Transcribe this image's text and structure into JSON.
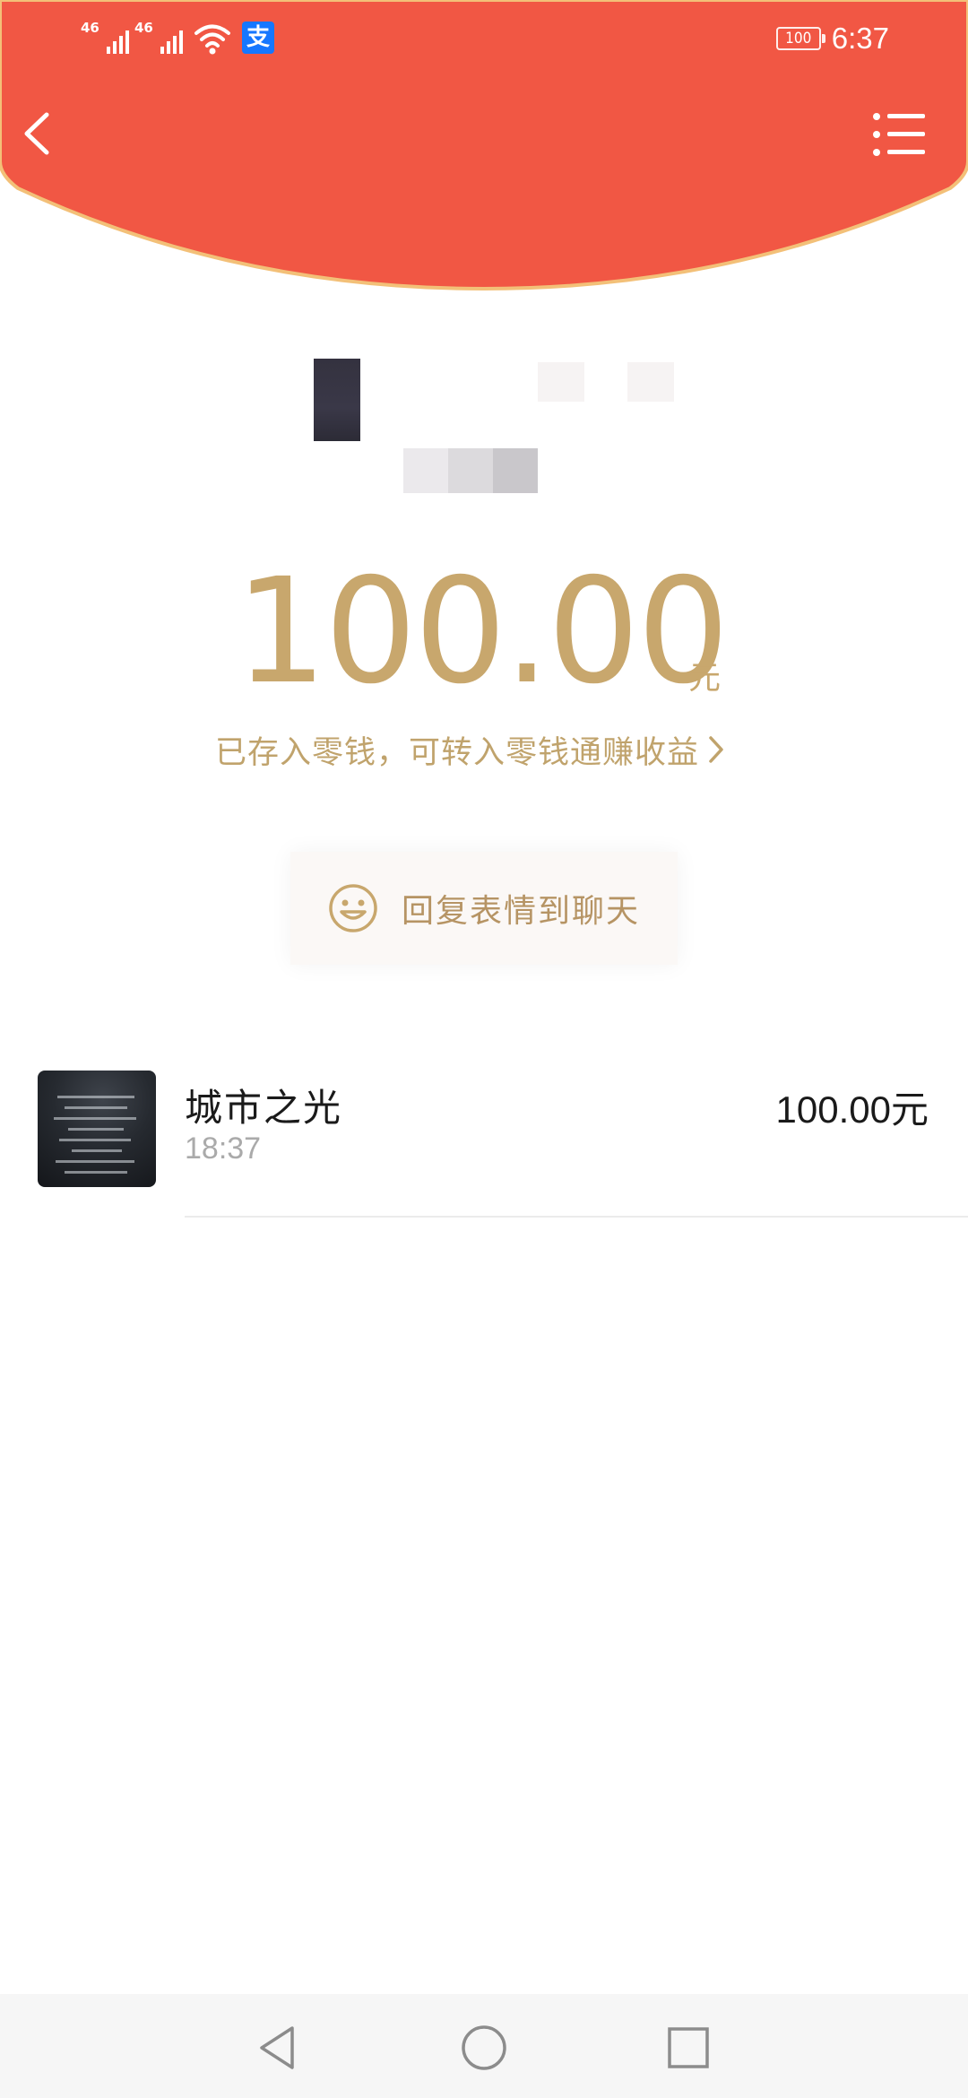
{
  "colors": {
    "header_red": "#f15744",
    "header_edge": "#f3c078",
    "gold": "#c8a76d",
    "gold_text": "#c0a36c",
    "reply_text": "#b69464"
  },
  "status_bar": {
    "network_1": "46",
    "network_2": "46",
    "wifi_icon": "wifi-icon",
    "app_icon": "alipay-icon",
    "app_icon_glyph": "支",
    "battery": "100",
    "time": "6:37"
  },
  "header": {
    "back_icon": "chevron-left-icon",
    "menu_icon": "menu-list-icon"
  },
  "packet": {
    "amount": "100.00",
    "unit": "元",
    "change_note": "已存入零钱，可转入零钱通赚收益",
    "reply_label": "回复表情到聊天",
    "reply_icon": "smile-icon"
  },
  "receivers": [
    {
      "name": "城市之光",
      "time": "18:37",
      "amount": "100.00元"
    }
  ],
  "nav": {
    "back_icon": "triangle-back-icon",
    "home_icon": "circle-home-icon",
    "recents_icon": "square-recents-icon"
  }
}
